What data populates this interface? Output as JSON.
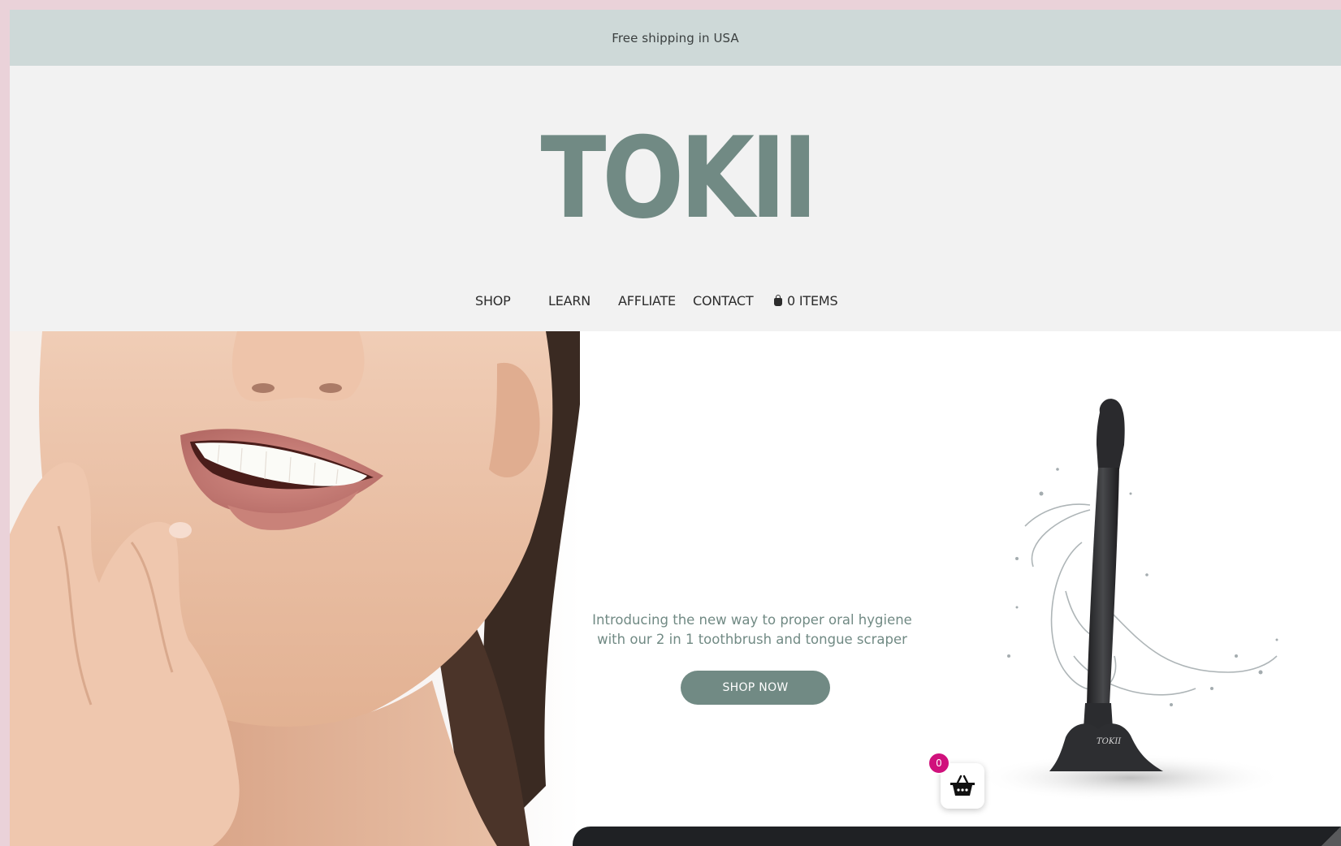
{
  "announcement": {
    "text": "Free shipping in USA"
  },
  "brand": {
    "logo_text": "TOKII",
    "color": "#718a84"
  },
  "nav": {
    "items": [
      {
        "label": "SHOP"
      },
      {
        "label": "LEARN"
      },
      {
        "label": "AFFLIATE"
      },
      {
        "label": "CONTACT"
      }
    ],
    "cart_label": "0 ITEMS"
  },
  "hero": {
    "tagline": "Introducing the new way to proper oral hygiene with our 2 in 1 toothbrush and tongue scraper",
    "cta_label": "SHOP NOW",
    "cta_color": "#718a84",
    "product_engraving": "TOKII"
  },
  "cart_widget": {
    "count": "0",
    "badge_color": "#d0117c",
    "icon": "basket-icon"
  }
}
